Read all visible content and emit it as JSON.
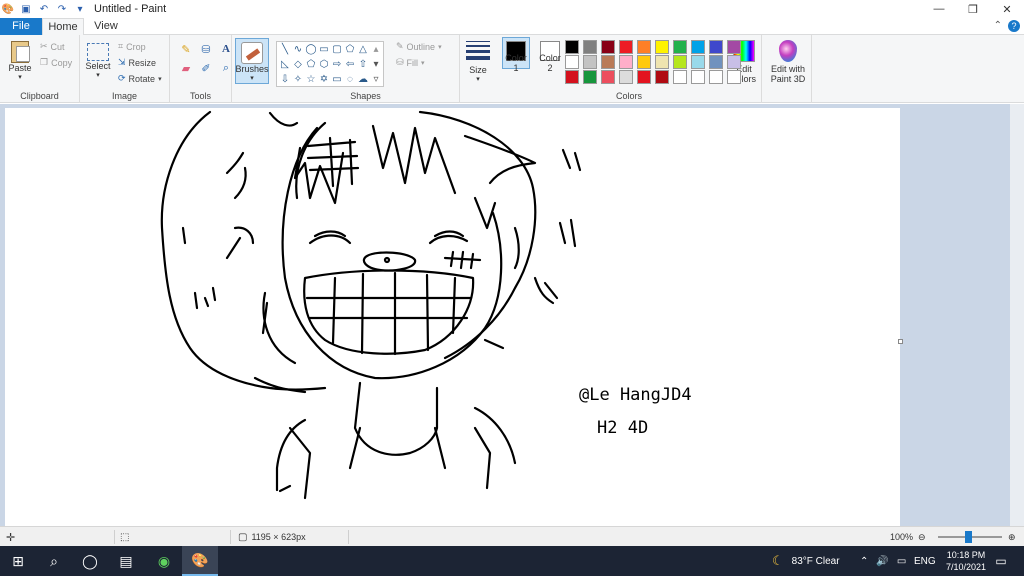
{
  "window": {
    "title": "Untitled - Paint",
    "controls": [
      "—",
      "❐",
      "✕"
    ]
  },
  "quick_access": [
    "save-icon",
    "undo-icon",
    "redo-icon"
  ],
  "tabs": {
    "file": "File",
    "home": "Home",
    "view": "View"
  },
  "ribbon": {
    "clipboard": {
      "label": "Clipboard",
      "paste": "Paste",
      "cut": "Cut",
      "copy": "Copy"
    },
    "image": {
      "label": "Image",
      "select": "Select",
      "crop": "Crop",
      "resize": "Resize",
      "rotate": "Rotate"
    },
    "tools": {
      "label": "Tools"
    },
    "brushes": {
      "label": "Brushes"
    },
    "shapes": {
      "label": "Shapes",
      "outline": "Outline",
      "fill": "Fill"
    },
    "size": {
      "label": "Size"
    },
    "colors": {
      "label": "Colors",
      "color1_label": "Color",
      "color1_num": "1",
      "color2_label": "Color",
      "color2_num": "2",
      "color1_value": "#000000",
      "color2_value": "#ffffff",
      "palette": [
        "#000000",
        "#7f7f7f",
        "#880015",
        "#ed1c24",
        "#ff7f27",
        "#fff200",
        "#22b14c",
        "#00a2e8",
        "#3f48cc",
        "#a349a4",
        "#ffffff",
        "#c3c3c3",
        "#b97a57",
        "#ffaec9",
        "#ffc90e",
        "#efe4b0",
        "#b5e61d",
        "#99d9ea",
        "#7092be",
        "#c8bfe7",
        "#d4111d",
        "#17963c",
        "#ec4e5e",
        "#dcdcdc",
        "#e3141f",
        "#b00b12",
        "#ffffff",
        "#ffffff",
        "#ffffff",
        "#ffffff"
      ],
      "edit_colors_1": "Edit",
      "edit_colors_2": "colors"
    },
    "paint3d": {
      "line1": "Edit with",
      "line2": "Paint 3D"
    }
  },
  "canvas": {
    "signature_line1": "@Le HangJD4",
    "signature_line2": "H2 4D"
  },
  "status": {
    "dimensions": "1195 × 623px",
    "zoom": "100%"
  },
  "taskbar": {
    "weather": "83°F  Clear",
    "lang": "ENG",
    "time": "10:18 PM",
    "date": "7/10/2021"
  }
}
